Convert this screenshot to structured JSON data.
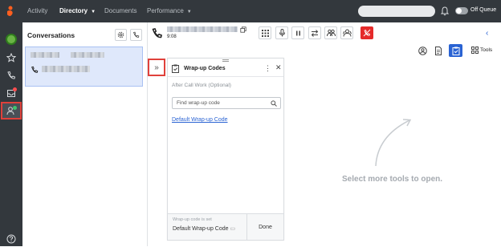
{
  "topbar": {
    "nav": [
      {
        "label": "Activity"
      },
      {
        "label": "Directory"
      },
      {
        "label": "Documents"
      },
      {
        "label": "Performance"
      }
    ],
    "queue_label": "Off Queue"
  },
  "conversations": {
    "title": "Conversations"
  },
  "call": {
    "duration": "9:08"
  },
  "tools_row": {
    "tools_label": "Tools"
  },
  "wrapup": {
    "title": "Wrap-up Codes",
    "acw_label": "After Call Work (Optional)",
    "search_placeholder": "Find wrap-up code",
    "default_code_link": "Default Wrap-up Code",
    "footer_set_label": "Wrap-up code is set",
    "footer_selected": "Default Wrap-up Code",
    "done_label": "Done"
  },
  "main": {
    "empty_message": "Select more tools to open."
  },
  "colors": {
    "topbar_bg": "#33383d",
    "accent_blue": "#2a63d3",
    "highlight_red": "#e0413b",
    "end_call_red": "#e52a2a",
    "conversation_card": "#dfe8fb"
  }
}
